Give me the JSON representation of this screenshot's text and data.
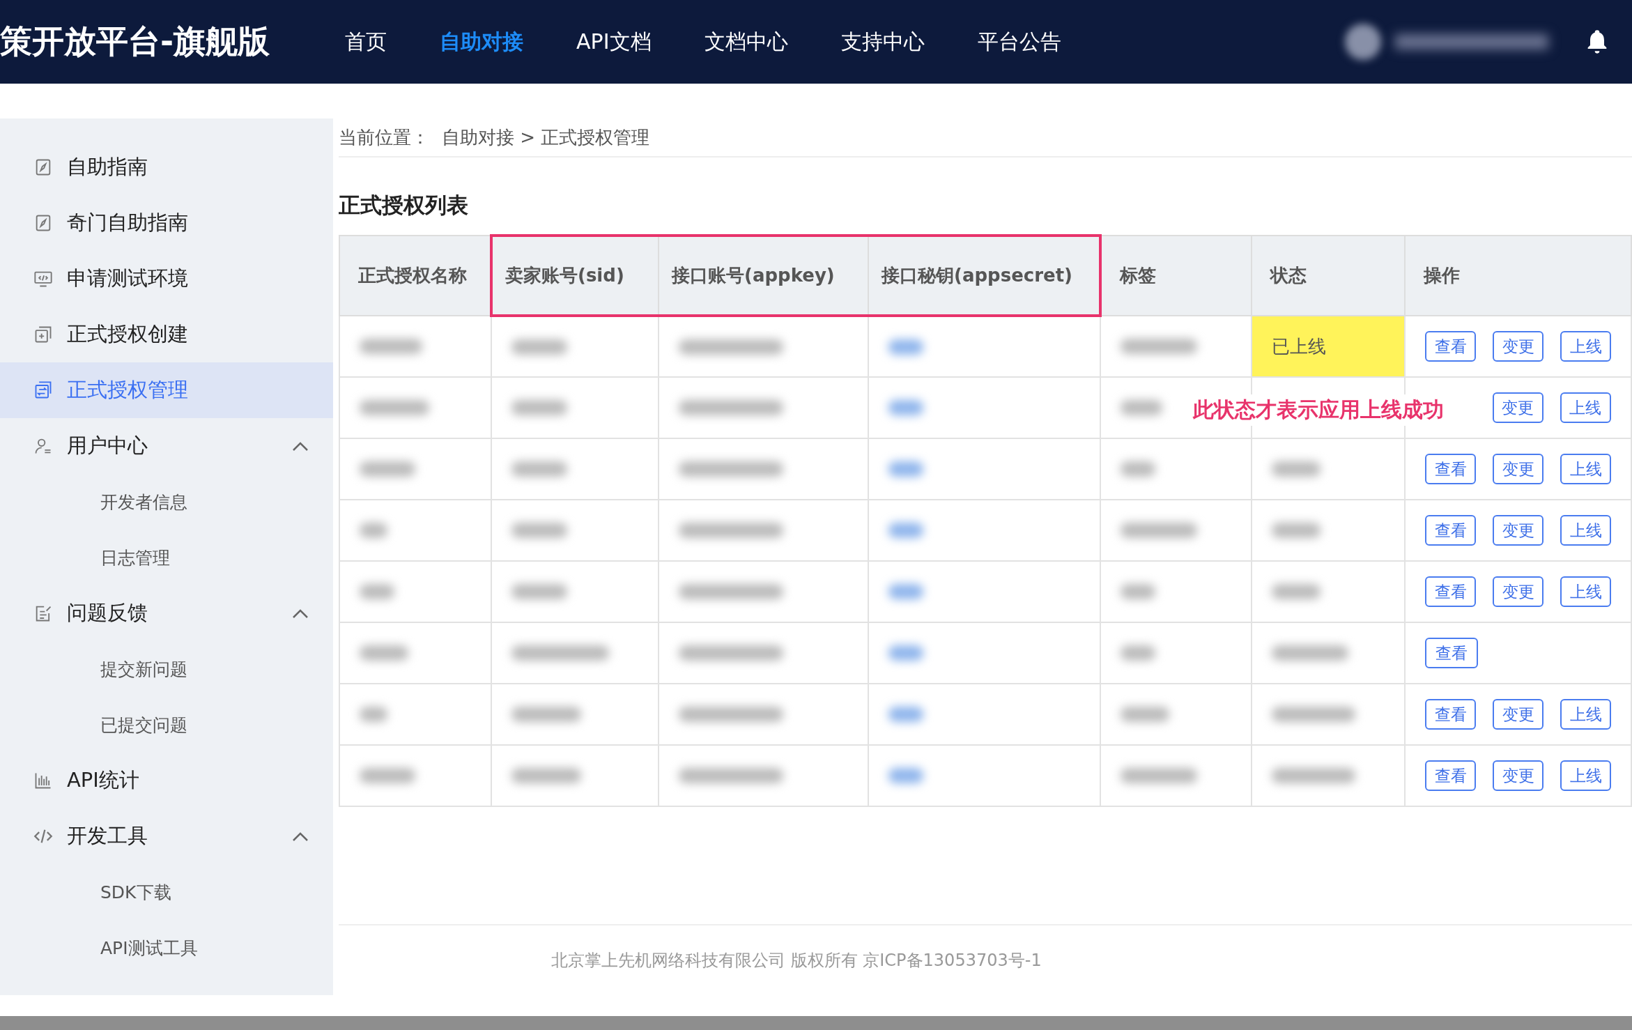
{
  "header": {
    "logo": "策开放平台-旗舰版",
    "nav": [
      {
        "label": "首页",
        "selected": false
      },
      {
        "label": "自助对接",
        "selected": true
      },
      {
        "label": "API文档",
        "selected": false
      },
      {
        "label": "文档中心",
        "selected": false
      },
      {
        "label": "支持中心",
        "selected": false
      },
      {
        "label": "平台公告",
        "selected": false
      }
    ]
  },
  "sidebar": {
    "items": [
      {
        "kind": "item",
        "label": "自助指南",
        "selected": false
      },
      {
        "kind": "item",
        "label": "奇门自助指南",
        "selected": false
      },
      {
        "kind": "item",
        "label": "申请测试环境",
        "selected": false
      },
      {
        "kind": "item",
        "label": "正式授权创建",
        "selected": false
      },
      {
        "kind": "item",
        "label": "正式授权管理",
        "selected": true
      },
      {
        "kind": "group",
        "label": "用户中心",
        "expanded": true,
        "children": [
          {
            "label": "开发者信息"
          },
          {
            "label": "日志管理"
          }
        ]
      },
      {
        "kind": "group",
        "label": "问题反馈",
        "expanded": true,
        "children": [
          {
            "label": "提交新问题"
          },
          {
            "label": "已提交问题"
          }
        ]
      },
      {
        "kind": "item",
        "label": "API统计",
        "selected": false
      },
      {
        "kind": "group",
        "label": "开发工具",
        "expanded": true,
        "children": [
          {
            "label": "SDK下载"
          },
          {
            "label": "API测试工具"
          }
        ]
      }
    ]
  },
  "breadcrumb": {
    "prefix": "当前位置：",
    "path": "自助对接 > 正式授权管理"
  },
  "page_title": "正式授权列表",
  "table": {
    "columns": [
      {
        "label": "正式授权名称",
        "highlighted": false
      },
      {
        "label": "卖家账号(sid)",
        "highlighted": true
      },
      {
        "label": "接口账号(appkey)",
        "highlighted": true
      },
      {
        "label": "接口秘钥(appsecret)",
        "highlighted": true
      },
      {
        "label": "标签",
        "highlighted": false
      },
      {
        "label": "状态",
        "highlighted": false
      },
      {
        "label": "操作",
        "highlighted": false
      }
    ],
    "rows": [
      {
        "status": "已上线",
        "status_highlighted": true,
        "actions": [
          "查看",
          "变更",
          "上线"
        ]
      },
      {
        "status_highlighted": false,
        "first_action_covered": true,
        "actions": [
          "变更",
          "上线"
        ]
      },
      {
        "status_highlighted": false,
        "actions": [
          "查看",
          "变更",
          "上线"
        ]
      },
      {
        "status_highlighted": false,
        "actions": [
          "查看",
          "变更",
          "上线"
        ]
      },
      {
        "status_highlighted": false,
        "actions": [
          "查看",
          "变更",
          "上线"
        ]
      },
      {
        "status_highlighted": false,
        "actions": [
          "查看"
        ]
      },
      {
        "status_highlighted": false,
        "actions": [
          "查看",
          "变更",
          "上线"
        ]
      },
      {
        "status_highlighted": false,
        "actions": [
          "查看",
          "变更",
          "上线"
        ]
      }
    ]
  },
  "annotation": "此状态才表示应用上线成功",
  "footer": "北京掌上先机网络科技有限公司 版权所有 京ICP备13053703号-1"
}
